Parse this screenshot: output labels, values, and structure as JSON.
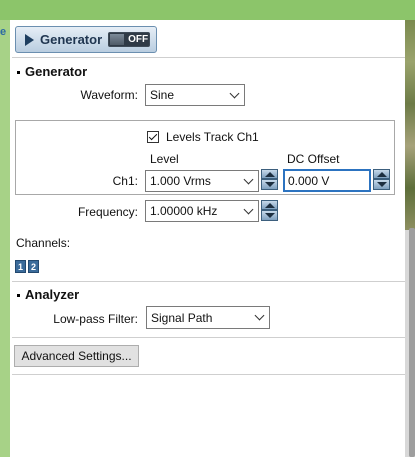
{
  "generator_button": {
    "label": "Generator",
    "toggle_state": "OFF"
  },
  "generator_section": {
    "title": "Generator",
    "waveform": {
      "label": "Waveform:",
      "value": "Sine"
    },
    "levels_track": {
      "label": "Levels Track Ch1",
      "checked": true
    },
    "level_header": "Level",
    "dc_offset_header": "DC Offset",
    "ch1": {
      "label": "Ch1:",
      "level_value": "1.000 Vrms",
      "dc_offset_value": "0.000 V"
    },
    "frequency": {
      "label": "Frequency:",
      "value": "1.00000 kHz"
    }
  },
  "channels": {
    "label": "Channels:",
    "items": [
      "1",
      "2"
    ]
  },
  "analyzer_section": {
    "title": "Analyzer",
    "lowpass": {
      "label": "Low-pass Filter:",
      "value": "Signal Path"
    }
  },
  "advanced_button": {
    "label": "Advanced Settings..."
  },
  "colors": {
    "accent_green": "#8cc56a",
    "focus_blue": "#2c73c0",
    "button_blue": "#b9cde0"
  }
}
